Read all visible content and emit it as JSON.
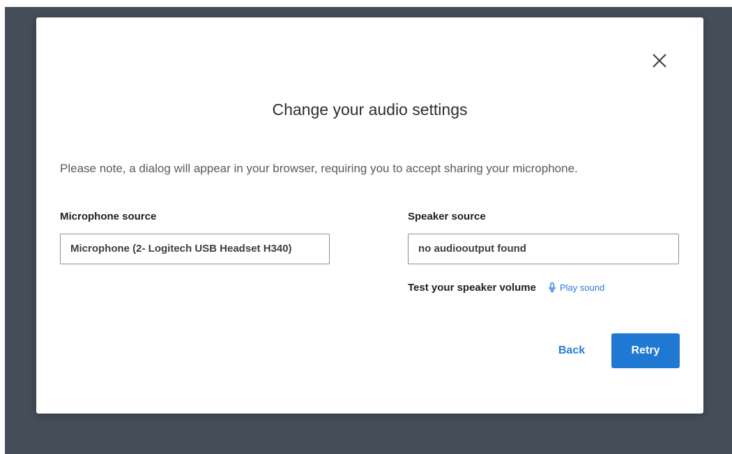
{
  "dialog": {
    "title": "Change your audio settings",
    "note": "Please note, a dialog will appear in your browser, requiring you to accept sharing your microphone.",
    "close_icon": "close-icon"
  },
  "microphone": {
    "label": "Microphone source",
    "selected": "Microphone (2- Logitech USB Headset H340)"
  },
  "speaker": {
    "label": "Speaker source",
    "selected": "no audiooutput found",
    "test_label": "Test your speaker volume",
    "play_label": "Play sound",
    "play_icon": "microphone-icon"
  },
  "actions": {
    "back_label": "Back",
    "retry_label": "Retry"
  },
  "colors": {
    "backdrop": "#444d58",
    "accent": "#1f78d1",
    "link": "#2a7bd5"
  }
}
